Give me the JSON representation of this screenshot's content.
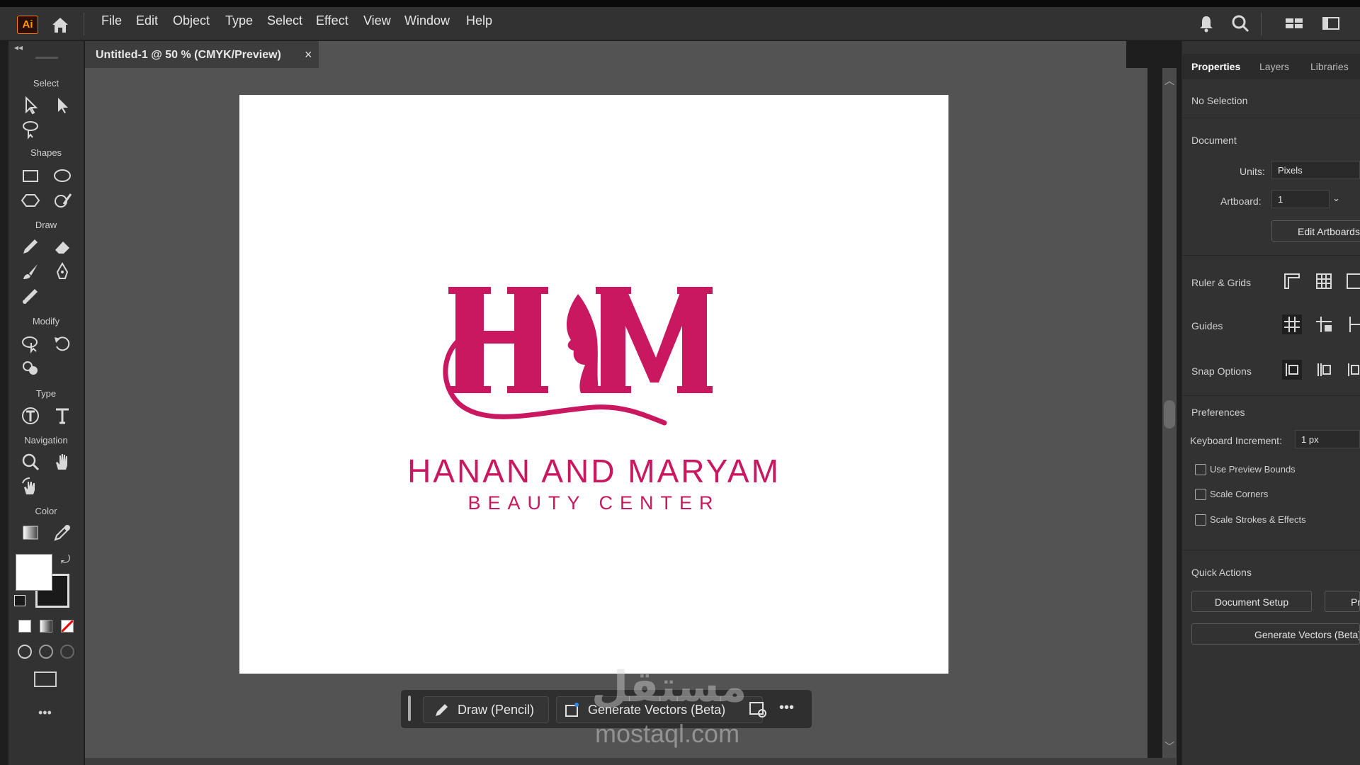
{
  "app": {
    "logo": "Ai",
    "accent": "#ff9a00"
  },
  "menu": [
    "File",
    "Edit",
    "Object",
    "Type",
    "Select",
    "Effect",
    "View",
    "Window",
    "Help"
  ],
  "document_tab": {
    "title": "Untitled-1 @ 50 % (CMYK/Preview)",
    "close": "×"
  },
  "toolbar": {
    "sections": {
      "select": "Select",
      "shapes": "Shapes",
      "draw": "Draw",
      "modify": "Modify",
      "type": "Type",
      "navigation": "Navigation",
      "color": "Color"
    },
    "more": "•••"
  },
  "artboard": {
    "logo_letters": "HM",
    "brand_name": "HANAN AND MARYAM",
    "brand_subtitle": "BEAUTY CENTER",
    "brand_color": "#c9185f"
  },
  "taskbar": {
    "draw_label": "Draw (Pencil)",
    "generate_label": "Generate Vectors (Beta)",
    "more": "•••"
  },
  "watermark": {
    "arabic": "مستقل",
    "latin": "mostaql.com"
  },
  "properties": {
    "tabs": [
      "Properties",
      "Layers",
      "Libraries"
    ],
    "selection": "No Selection",
    "document_heading": "Document",
    "units_label": "Units:",
    "units_value": "Pixels",
    "artboard_label": "Artboard:",
    "artboard_value": "1",
    "edit_artboards": "Edit Artboards",
    "ruler_grids": "Ruler & Grids",
    "guides": "Guides",
    "snap_options": "Snap Options",
    "preferences": "Preferences",
    "keyboard_increment_label": "Keyboard Increment:",
    "keyboard_increment_value": "1 px",
    "checkboxes": [
      "Use Preview Bounds",
      "Scale Corners",
      "Scale Strokes & Effects"
    ],
    "quick_actions": "Quick Actions",
    "document_setup": "Document Setup",
    "preferences_btn": "Pr",
    "generate_vectors": "Generate Vectors (Beta)"
  }
}
